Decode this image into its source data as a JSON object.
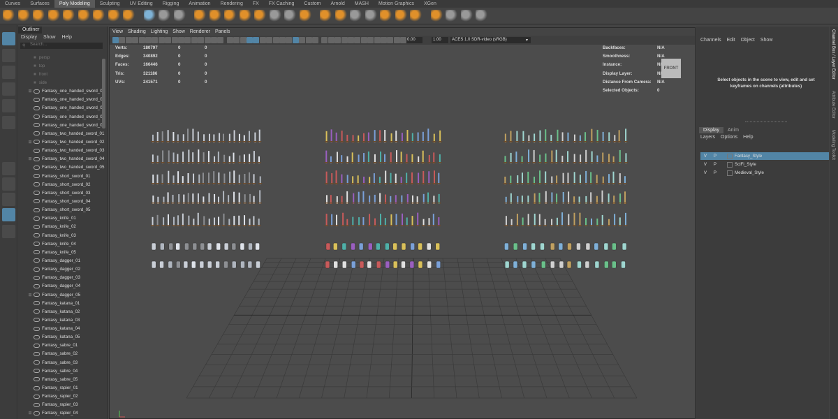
{
  "shelf_tabs": [
    "Curves",
    "Surfaces",
    "Poly Modeling",
    "Sculpting",
    "UV Editing",
    "Rigging",
    "Animation",
    "Rendering",
    "FX",
    "FX Caching",
    "Custom",
    "Arnold",
    "MASH",
    "Motion Graphics",
    "XGen"
  ],
  "shelf_active": "Poly Modeling",
  "outliner": {
    "title": "Outliner",
    "menu": [
      "Display",
      "Show",
      "Help"
    ],
    "search_placeholder": "Search...",
    "cameras": [
      "persp",
      "top",
      "front",
      "side"
    ],
    "items": [
      {
        "label": "Fantasy_one_handed_sword_01",
        "expandable": true
      },
      {
        "label": "Fantasy_one_handed_sword_02",
        "expandable": false
      },
      {
        "label": "Fantasy_one_handed_sword_03",
        "expandable": false
      },
      {
        "label": "Fantasy_one_handed_sword_04",
        "expandable": false
      },
      {
        "label": "Fantasy_one_handed_sword_05",
        "expandable": false
      },
      {
        "label": "Fantasy_two_handed_sword_01",
        "expandable": false
      },
      {
        "label": "Fantasy_two_handed_sword_02",
        "expandable": true
      },
      {
        "label": "Fantasy_two_handed_sword_03",
        "expandable": false
      },
      {
        "label": "Fantasy_two_handed_sword_04",
        "expandable": true
      },
      {
        "label": "Fantasy_two_handed_sword_05",
        "expandable": false
      },
      {
        "label": "Fantasy_short_sword_01",
        "expandable": false
      },
      {
        "label": "Fantasy_short_sword_02",
        "expandable": false
      },
      {
        "label": "Fantasy_short_sword_03",
        "expandable": false
      },
      {
        "label": "Fantasy_short_sword_04",
        "expandable": false
      },
      {
        "label": "Fantasy_short_sword_05",
        "expandable": false
      },
      {
        "label": "Fantasy_knife_01",
        "expandable": false
      },
      {
        "label": "Fantasy_knife_02",
        "expandable": false
      },
      {
        "label": "Fantasy_knife_03",
        "expandable": false
      },
      {
        "label": "Fantasy_knife_04",
        "expandable": false
      },
      {
        "label": "Fantasy_knife_05",
        "expandable": false
      },
      {
        "label": "Fantasy_dagger_01",
        "expandable": false
      },
      {
        "label": "Fantasy_dagger_02",
        "expandable": false
      },
      {
        "label": "Fantasy_dagger_03",
        "expandable": false
      },
      {
        "label": "Fantasy_dagger_04",
        "expandable": false
      },
      {
        "label": "Fantasy_dagger_05",
        "expandable": true
      },
      {
        "label": "Fantasy_katana_01",
        "expandable": false
      },
      {
        "label": "Fantasy_katana_02",
        "expandable": false
      },
      {
        "label": "Fantasy_katana_03",
        "expandable": false
      },
      {
        "label": "Fantasy_katana_04",
        "expandable": false
      },
      {
        "label": "Fantasy_katana_05",
        "expandable": false
      },
      {
        "label": "Fantasy_sabre_01",
        "expandable": false
      },
      {
        "label": "Fantasy_sabre_02",
        "expandable": false
      },
      {
        "label": "Fantasy_sabre_03",
        "expandable": false
      },
      {
        "label": "Fantasy_sabre_04",
        "expandable": false
      },
      {
        "label": "Fantasy_sabre_05",
        "expandable": false
      },
      {
        "label": "Fantasy_rapier_01",
        "expandable": false
      },
      {
        "label": "Fantasy_rapier_02",
        "expandable": false
      },
      {
        "label": "Fantasy_rapier_03",
        "expandable": false
      },
      {
        "label": "Fantasy_rapier_04",
        "expandable": true
      }
    ]
  },
  "viewport": {
    "menu": [
      "View",
      "Shading",
      "Lighting",
      "Show",
      "Renderer",
      "Panels"
    ],
    "exposure": "0.00",
    "gamma": "1.00",
    "color_space": "ACES 1.0 SDR-video (sRGB)",
    "viewcube_label": "FRONT",
    "hud_left": [
      {
        "key": "Verts:",
        "v1": "180797",
        "v2": "0",
        "v3": "0"
      },
      {
        "key": "Edges:",
        "v1": "340892",
        "v2": "0",
        "v3": "0"
      },
      {
        "key": "Faces:",
        "v1": "166446",
        "v2": "0",
        "v3": "0"
      },
      {
        "key": "Tris:",
        "v1": "321186",
        "v2": "0",
        "v3": "0"
      },
      {
        "key": "UVs:",
        "v1": "241571",
        "v2": "0",
        "v3": "0"
      }
    ],
    "hud_right": [
      {
        "key": "Backfaces:",
        "value": "N/A"
      },
      {
        "key": "Smoothness:",
        "value": "N/A"
      },
      {
        "key": "Instance:",
        "value": "N/A"
      },
      {
        "key": "Display Layer:",
        "value": "N/A"
      },
      {
        "key": "Distance From Camera:",
        "value": "N/A"
      },
      {
        "key": "Selected Objects:",
        "value": "0"
      }
    ]
  },
  "channel_box": {
    "menu": [
      "Channels",
      "Edit",
      "Object",
      "Show"
    ],
    "message": "Select objects in the scene to view, edit and set keyframes on channels (attributes)"
  },
  "layer_editor": {
    "tabs": [
      "Display",
      "Anim"
    ],
    "menu": [
      "Layers",
      "Options",
      "Help"
    ],
    "layers": [
      {
        "v": "V",
        "p": "P",
        "name": "Fantasy_Style",
        "selected": true
      },
      {
        "v": "V",
        "p": "P",
        "name": "SciFi_Style",
        "selected": false
      },
      {
        "v": "V",
        "p": "P",
        "name": "Medieval_Style",
        "selected": false
      }
    ]
  },
  "side_tabs": [
    "Channel Box / Layer Editor",
    "Attribute Editor",
    "Modeling Toolkit"
  ]
}
